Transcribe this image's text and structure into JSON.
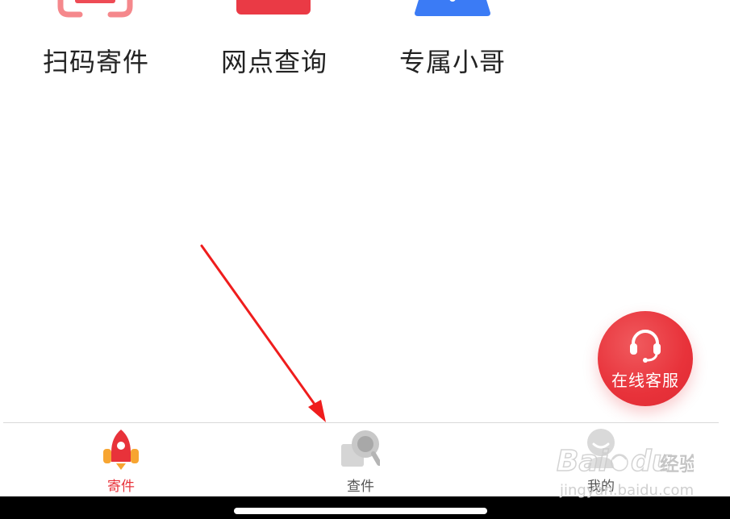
{
  "shortcuts": [
    {
      "label": "扫码寄件",
      "icon": "scan-icon",
      "color": "#f26b70"
    },
    {
      "label": "网点查询",
      "icon": "outlet-icon",
      "color": "#ea3a45"
    },
    {
      "label": "专属小哥",
      "icon": "courier-icon",
      "color": "#3b7bf5"
    }
  ],
  "floating_service": {
    "label": "在线客服",
    "icon": "headset-icon",
    "color": "#e8323a"
  },
  "tabbar": {
    "items": [
      {
        "label": "寄件",
        "icon": "rocket-icon",
        "active": true
      },
      {
        "label": "查件",
        "icon": "package-search-icon",
        "active": false
      },
      {
        "label": "我的",
        "icon": "user-icon",
        "active": false
      }
    ],
    "active_color": "#e8323a",
    "inactive_color": "#555555"
  },
  "annotation": {
    "type": "red-arrow",
    "points_to": "查件"
  },
  "watermark": {
    "text": "Baidu经验",
    "subtext": "jingyan.baidu.com"
  }
}
